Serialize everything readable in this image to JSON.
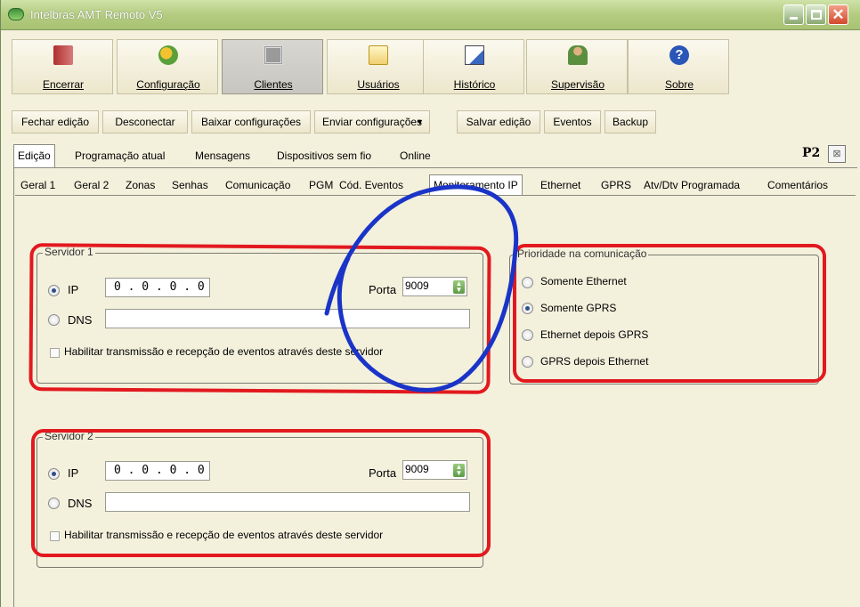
{
  "window": {
    "title": "Intelbras AMT Remoto V5"
  },
  "main_toolbar": [
    {
      "label": "Encerrar",
      "icon": "door-icon"
    },
    {
      "label": "Configuração",
      "icon": "settings-icon"
    },
    {
      "label": "Clientes",
      "icon": "clients-icon",
      "active": true
    },
    {
      "label": "Usuários",
      "icon": "folder-icon"
    },
    {
      "label": "Histórico",
      "icon": "history-icon"
    },
    {
      "label": "Supervisão",
      "icon": "supervision-icon"
    },
    {
      "label": "Sobre",
      "icon": "help-icon"
    }
  ],
  "secondary_toolbar": {
    "fechar": "Fechar edição",
    "desconectar": "Desconectar",
    "baixar": "Baixar configurações",
    "enviar": "Enviar configurações",
    "salvar": "Salvar edição",
    "eventos": "Eventos",
    "backup": "Backup"
  },
  "tabs_top": {
    "edicao": "Edição",
    "programacao": "Programação atual",
    "mensagens": "Mensagens",
    "dispositivos": "Dispositivos sem fio",
    "online": "Online",
    "panel_id": "P2"
  },
  "tabs_sub": {
    "geral1": "Geral 1",
    "geral2": "Geral 2",
    "zonas": "Zonas",
    "senhas": "Senhas",
    "comunicacao": "Comunicação",
    "pgm": "PGM",
    "cod_eventos": "Cód. Eventos",
    "monitoramento": "Monitoramento IP",
    "ethernet": "Ethernet",
    "gprs": "GPRS",
    "atv": "Atv/Dtv Programada",
    "comentarios": "Comentários"
  },
  "servidor1": {
    "title": "Servidor 1",
    "ip_label": "IP",
    "ip_value": "0 . 0 . 0 . 0",
    "dns_label": "DNS",
    "dns_value": "",
    "porta_label": "Porta",
    "porta_value": "9009",
    "checkbox_label": "Habilitar transmissão e recepção de eventos através deste servidor",
    "selected": "IP"
  },
  "servidor2": {
    "title": "Servidor 2",
    "ip_label": "IP",
    "ip_value": "0 . 0 . 0 . 0",
    "dns_label": "DNS",
    "dns_value": "",
    "porta_label": "Porta",
    "porta_value": "9009",
    "checkbox_label": "Habilitar transmissão e recepção de eventos através deste servidor",
    "selected": "IP"
  },
  "prioridade": {
    "title": "Prioridade na comunicação",
    "options": [
      "Somente Ethernet",
      "Somente GPRS",
      "Ethernet depois GPRS",
      "GPRS depois Ethernet"
    ],
    "selected": "Somente GPRS"
  },
  "annotations": {
    "box_color": "#e2191f",
    "circle_color": "#1a34c8"
  }
}
